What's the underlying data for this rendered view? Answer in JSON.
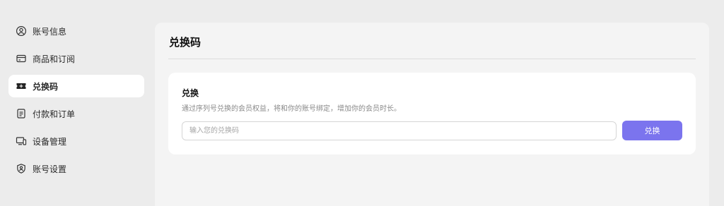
{
  "sidebar": {
    "items": [
      {
        "label": "账号信息",
        "icon": "user-circle-icon",
        "active": false
      },
      {
        "label": "商品和订阅",
        "icon": "credit-card-icon",
        "active": false
      },
      {
        "label": "兑换码",
        "icon": "ticket-icon",
        "active": true
      },
      {
        "label": "付款和订单",
        "icon": "receipt-icon",
        "active": false
      },
      {
        "label": "设备管理",
        "icon": "devices-icon",
        "active": false
      },
      {
        "label": "账号设置",
        "icon": "shield-user-icon",
        "active": false
      }
    ]
  },
  "main": {
    "title": "兑换码",
    "card": {
      "title": "兑换",
      "description": "通过序列号兑换的会员权益，将和你的账号绑定，增加你的会员时长。",
      "input": {
        "placeholder": "输入您的兑换码",
        "value": ""
      },
      "button_label": "兑换"
    }
  },
  "colors": {
    "accent": "#7b74ee",
    "page_background": "#ececec",
    "panel_background": "#f4f4f4",
    "card_background": "#ffffff"
  }
}
